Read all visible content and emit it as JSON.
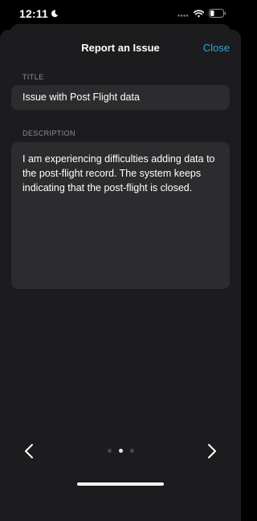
{
  "status_bar": {
    "time": "12:11",
    "moon_icon": "moon-icon",
    "signal_icon": "cellular-signal-icon",
    "wifi_icon": "wifi-icon",
    "battery_icon": "battery-icon"
  },
  "header": {
    "title": "Report an Issue",
    "close_label": "Close"
  },
  "form": {
    "title_label": "TITLE",
    "title_value": "Issue with Post Flight data",
    "description_label": "DESCRIPTION",
    "description_value": "I am experiencing difficulties adding data to the post-flight record. The system keeps indicating that the post-flight is closed."
  },
  "pager": {
    "page_count": 3,
    "current_page": 2,
    "prev_icon": "chevron-left-icon",
    "next_icon": "chevron-right-icon"
  },
  "colors": {
    "accent": "#34a3d6",
    "sheet_background": "#1c1c1e",
    "field_background": "#2c2c2e",
    "label_gray": "#8e8e93"
  }
}
